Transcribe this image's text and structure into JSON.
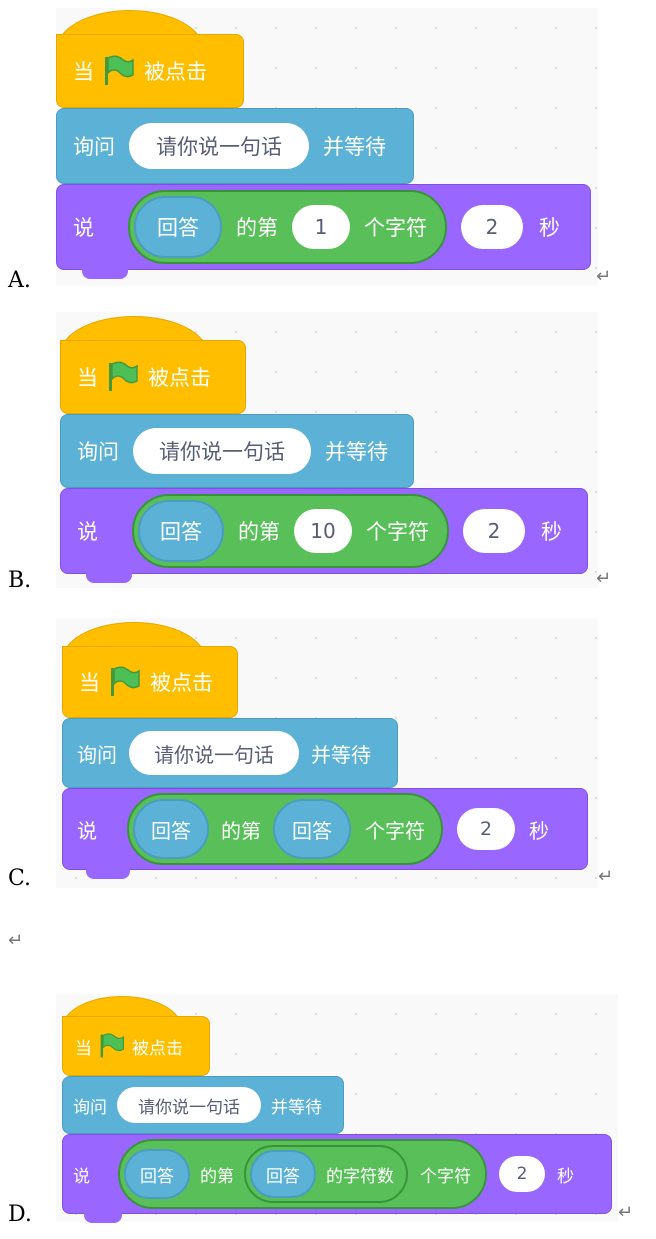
{
  "options": [
    {
      "label": "A.",
      "hat": {
        "prefix": "当",
        "suffix": "被点击"
      },
      "ask": {
        "prefix": "询问",
        "input": "请你说一句话",
        "suffix": "并等待"
      },
      "say": {
        "prefix": "说",
        "answer": "回答",
        "mid": "的第",
        "index": "1",
        "char_label": "个字符",
        "seconds": "2",
        "unit": "秒"
      }
    },
    {
      "label": "B.",
      "hat": {
        "prefix": "当",
        "suffix": "被点击"
      },
      "ask": {
        "prefix": "询问",
        "input": "请你说一句话",
        "suffix": "并等待"
      },
      "say": {
        "prefix": "说",
        "answer": "回答",
        "mid": "的第",
        "index": "10",
        "char_label": "个字符",
        "seconds": "2",
        "unit": "秒"
      }
    },
    {
      "label": "C.",
      "hat": {
        "prefix": "当",
        "suffix": "被点击"
      },
      "ask": {
        "prefix": "询问",
        "input": "请你说一句话",
        "suffix": "并等待"
      },
      "say": {
        "prefix": "说",
        "answer": "回答",
        "mid": "的第",
        "index_answer": "回答",
        "char_label": "个字符",
        "seconds": "2",
        "unit": "秒"
      }
    },
    {
      "label": "D.",
      "hat": {
        "prefix": "当",
        "suffix": "被点击"
      },
      "ask": {
        "prefix": "询问",
        "input": "请你说一句话",
        "suffix": "并等待"
      },
      "say": {
        "prefix": "说",
        "answer": "回答",
        "mid": "的第",
        "len_answer": "回答",
        "len_label": "的字符数",
        "char_label": "个字符",
        "seconds": "2",
        "unit": "秒"
      }
    }
  ],
  "return_mark": "↵",
  "icons": {
    "flag": "green-flag-icon"
  },
  "colors": {
    "events": "#ffbf00",
    "sensing": "#5cb1d6",
    "looks": "#9966ff",
    "operators": "#59c059",
    "flag": "#4cbf56"
  }
}
